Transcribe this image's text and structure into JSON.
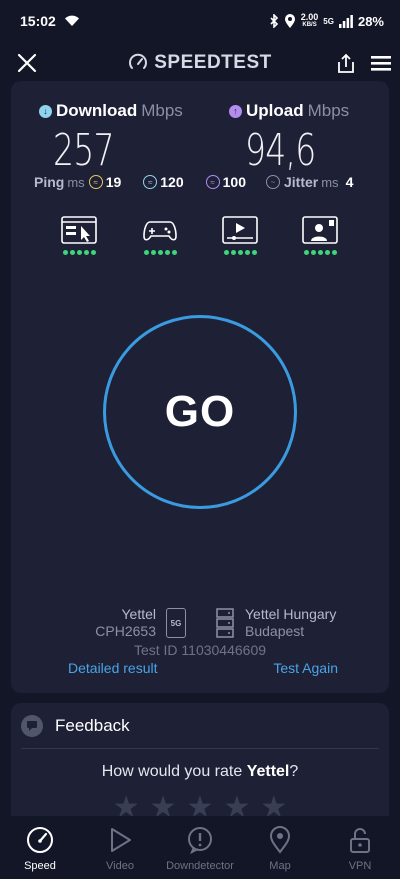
{
  "status_bar": {
    "time": "15:02",
    "net_speed": "2.00",
    "net_unit": "KB/S",
    "battery": "28%",
    "network": "5G"
  },
  "header": {
    "title": "SPEEDTEST"
  },
  "download": {
    "label": "Download",
    "unit": "Mbps",
    "value": "257"
  },
  "upload": {
    "label": "Upload",
    "unit": "Mbps",
    "value": "94,6"
  },
  "ping": {
    "label": "Ping",
    "unit": "ms",
    "idle": "19",
    "download": "120",
    "upload": "100",
    "jitter_label": "Jitter",
    "jitter_unit": "ms",
    "jitter": "4"
  },
  "activities": [
    {
      "name": "browsing",
      "rating": 5
    },
    {
      "name": "gaming",
      "rating": 5
    },
    {
      "name": "streaming",
      "rating": 5
    },
    {
      "name": "video-calls",
      "rating": 5
    }
  ],
  "go_label": "GO",
  "connection": {
    "provider": "Yettel",
    "device": "CPH2653",
    "network_badge": "5G",
    "server_name": "Yettel Hungary",
    "server_city": "Budapest",
    "test_id": "Test ID 11030446609",
    "detailed_result": "Detailed result",
    "test_again": "Test Again"
  },
  "feedback": {
    "title": "Feedback",
    "question_prefix": "How would you rate ",
    "question_subject": "Yettel",
    "question_suffix": "?",
    "stars": 5
  },
  "nav": [
    {
      "label": "Speed",
      "icon": "speedometer-icon",
      "active": true
    },
    {
      "label": "Video",
      "icon": "play-icon",
      "active": false
    },
    {
      "label": "Downdetector",
      "icon": "alert-icon",
      "active": false
    },
    {
      "label": "Map",
      "icon": "map-pin-icon",
      "active": false
    },
    {
      "label": "VPN",
      "icon": "lock-icon",
      "active": false
    }
  ],
  "colors": {
    "accent": "#3a9be0",
    "background": "#131626",
    "card": "#1e2136",
    "good": "#3ed67a",
    "download": "#8fd3ee",
    "upload": "#b38cf0",
    "idle": "#e8c763"
  }
}
